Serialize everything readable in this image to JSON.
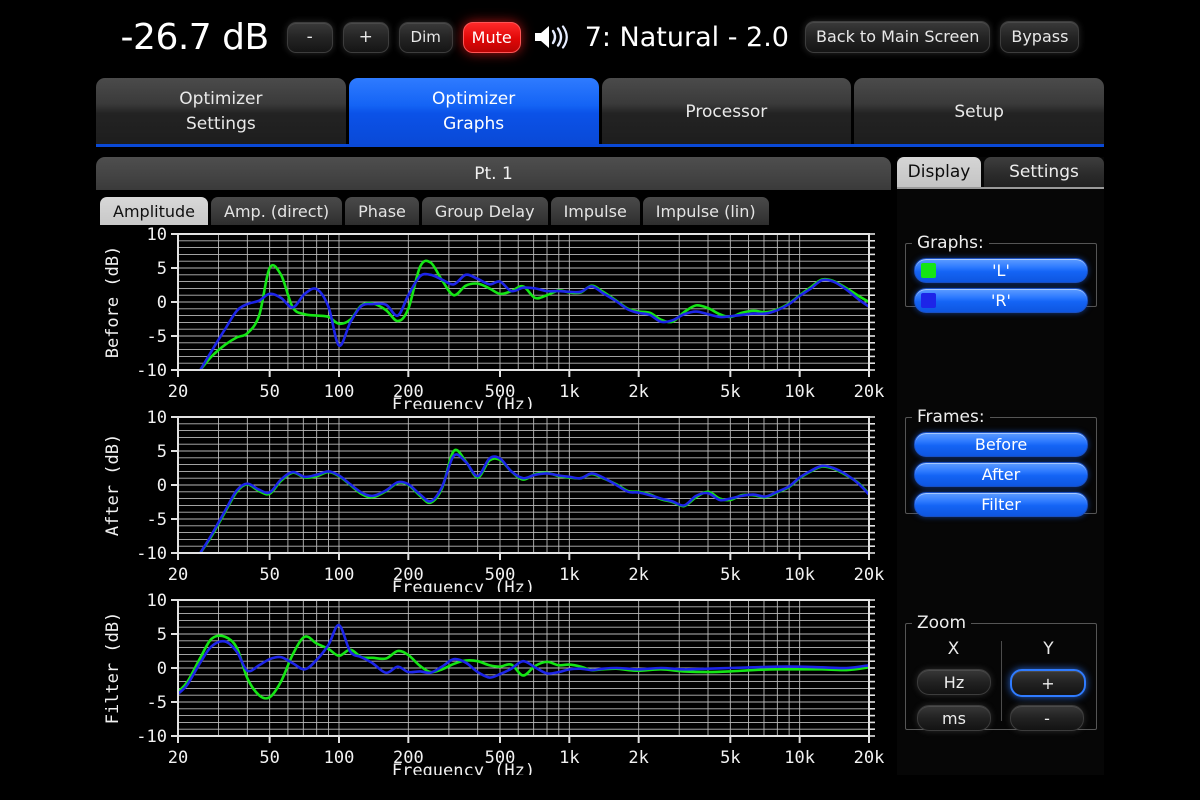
{
  "topbar": {
    "level": "-26.7 dB",
    "minus_label": "-",
    "plus_label": "+",
    "dim_label": "Dim",
    "mute_label": "Mute",
    "speaker_icon": "speaker-icon",
    "preset": "7: Natural - 2.0",
    "back_label": "Back to Main Screen",
    "bypass_label": "Bypass"
  },
  "main_tabs": [
    {
      "line1": "Optimizer",
      "line2": "Settings",
      "active": false
    },
    {
      "line1": "Optimizer",
      "line2": "Graphs",
      "active": true
    },
    {
      "line1": "Processor",
      "line2": "",
      "active": false
    },
    {
      "line1": "Setup",
      "line2": "",
      "active": false
    }
  ],
  "point_bar": {
    "label": "Pt. 1"
  },
  "sub_tabs": [
    {
      "label": "Amplitude",
      "active": true
    },
    {
      "label": "Amp. (direct)",
      "active": false
    },
    {
      "label": "Phase",
      "active": false
    },
    {
      "label": "Group Delay",
      "active": false
    },
    {
      "label": "Impulse",
      "active": false
    },
    {
      "label": "Impulse (lin)",
      "active": false
    }
  ],
  "right_panel": {
    "tabs": [
      {
        "label": "Display",
        "active": true
      },
      {
        "label": "Settings",
        "active": false
      }
    ],
    "graphs": {
      "legend": "Graphs:",
      "items": [
        {
          "label": "'L'",
          "color": "#15e515"
        },
        {
          "label": "'R'",
          "color": "#1d25e8"
        }
      ]
    },
    "frames": {
      "legend": "Frames:",
      "items": [
        {
          "label": "Before"
        },
        {
          "label": "After"
        },
        {
          "label": "Filter"
        }
      ]
    },
    "zoom": {
      "legend": "Zoom",
      "x_header": "X",
      "y_header": "Y",
      "x_buttons": [
        {
          "label": "Hz",
          "selected": false
        },
        {
          "label": "ms",
          "selected": false
        }
      ],
      "y_buttons": [
        {
          "label": "+",
          "selected": true
        },
        {
          "label": "-",
          "selected": false
        }
      ]
    }
  },
  "colors": {
    "accent_blue": "#0a49d6",
    "mute_red": "#e00707",
    "curve_left": "#15e515",
    "curve_right": "#1d25e8",
    "grid": "#b9b9b9",
    "plot_bg": "#000000"
  },
  "chart_data": [
    {
      "type": "line",
      "title": "Before",
      "ylabel": "Before (dB)",
      "xlabel": "Frequency (Hz)",
      "xscale": "log",
      "xlim": [
        20,
        20000
      ],
      "ylim": [
        -10,
        10
      ],
      "xticks": [
        20,
        50,
        100,
        200,
        500,
        1000,
        2000,
        5000,
        10000,
        20000
      ],
      "xticklabels": [
        "20",
        "50",
        "100",
        "200",
        "500",
        "1k",
        "2k",
        "5k",
        "10k",
        "20k"
      ],
      "yticks": [
        -10,
        -5,
        0,
        5,
        10
      ],
      "yticklabels": [
        "-10",
        "-5",
        "0",
        "5",
        "10"
      ],
      "grid": true,
      "legend": [
        "'L'",
        "'R'"
      ],
      "legend_position": "external-right",
      "series": [
        {
          "name": "'L'",
          "color": "#15e515",
          "x": [
            25,
            28,
            32,
            36,
            40,
            45,
            50,
            56,
            63,
            71,
            80,
            90,
            100,
            112,
            125,
            140,
            160,
            180,
            200,
            225,
            250,
            280,
            315,
            355,
            400,
            450,
            500,
            560,
            630,
            710,
            800,
            900,
            1000,
            1120,
            1250,
            1400,
            1600,
            1800,
            2000,
            2240,
            2500,
            2800,
            3150,
            3550,
            4000,
            4500,
            5000,
            5600,
            6300,
            7100,
            8000,
            9000,
            10000,
            11200,
            12500,
            14000,
            16000,
            18000,
            20000
          ],
          "y": [
            -10.0,
            -8.0,
            -6.3,
            -5.2,
            -4.6,
            -2.0,
            5.0,
            4.0,
            -0.8,
            -1.8,
            -2.0,
            -2.2,
            -3.2,
            -2.6,
            -0.5,
            -0.2,
            -1.2,
            -2.8,
            -1.0,
            5.2,
            5.8,
            3.2,
            1.0,
            2.4,
            2.7,
            2.0,
            1.2,
            1.6,
            2.3,
            0.6,
            1.0,
            1.7,
            1.4,
            1.4,
            2.4,
            1.5,
            0.2,
            -1.0,
            -1.4,
            -1.6,
            -2.6,
            -2.9,
            -1.5,
            -0.5,
            -0.9,
            -1.8,
            -2.2,
            -1.6,
            -1.3,
            -1.5,
            -1.1,
            -0.2,
            1.0,
            2.2,
            3.3,
            3.1,
            2.0,
            0.9,
            0.0
          ]
        },
        {
          "name": "'R'",
          "color": "#1d25e8",
          "x": [
            25,
            28,
            32,
            36,
            40,
            45,
            50,
            56,
            63,
            71,
            80,
            90,
            100,
            112,
            125,
            140,
            160,
            180,
            200,
            225,
            250,
            280,
            315,
            355,
            400,
            450,
            500,
            560,
            630,
            710,
            800,
            900,
            1000,
            1120,
            1250,
            1400,
            1600,
            1800,
            2000,
            2240,
            2500,
            2800,
            3150,
            3550,
            4000,
            4500,
            5000,
            5600,
            6300,
            7100,
            8000,
            9000,
            10000,
            11200,
            12500,
            14000,
            16000,
            18000,
            20000
          ],
          "y": [
            -10.0,
            -7.2,
            -4.0,
            -1.3,
            -0.3,
            0.2,
            1.2,
            0.6,
            -0.8,
            1.2,
            1.9,
            -0.7,
            -6.4,
            -3.0,
            -0.6,
            -0.3,
            -0.4,
            -2.0,
            1.0,
            3.8,
            4.0,
            3.3,
            2.6,
            4.0,
            3.4,
            2.6,
            3.0,
            1.6,
            2.1,
            2.0,
            1.6,
            1.6,
            1.5,
            1.5,
            2.3,
            1.3,
            0.1,
            -1.1,
            -1.6,
            -1.9,
            -2.9,
            -2.7,
            -1.8,
            -1.4,
            -1.8,
            -2.2,
            -2.1,
            -1.9,
            -1.7,
            -1.7,
            -1.2,
            -0.3,
            0.9,
            2.0,
            3.2,
            3.0,
            1.8,
            0.4,
            -0.7
          ]
        }
      ]
    },
    {
      "type": "line",
      "title": "After",
      "ylabel": "After (dB)",
      "xlabel": "Frequency (Hz)",
      "xscale": "log",
      "xlim": [
        20,
        20000
      ],
      "ylim": [
        -10,
        10
      ],
      "xticks": [
        20,
        50,
        100,
        200,
        500,
        1000,
        2000,
        5000,
        10000,
        20000
      ],
      "xticklabels": [
        "20",
        "50",
        "100",
        "200",
        "500",
        "1k",
        "2k",
        "5k",
        "10k",
        "20k"
      ],
      "yticks": [
        -10,
        -5,
        0,
        5,
        10
      ],
      "yticklabels": [
        "-10",
        "-5",
        "0",
        "5",
        "10"
      ],
      "grid": true,
      "series": [
        {
          "name": "'L'",
          "color": "#15e515",
          "x": [
            25,
            28,
            32,
            36,
            40,
            45,
            50,
            56,
            63,
            71,
            80,
            90,
            100,
            112,
            125,
            140,
            160,
            180,
            200,
            225,
            250,
            280,
            315,
            355,
            400,
            450,
            500,
            560,
            630,
            710,
            800,
            900,
            1000,
            1120,
            1250,
            1400,
            1600,
            1800,
            2000,
            2240,
            2500,
            2800,
            3150,
            3550,
            4000,
            4500,
            5000,
            5600,
            6300,
            7100,
            8000,
            9000,
            10000,
            11200,
            12500,
            14000,
            16000,
            18000,
            20000
          ],
          "y": [
            -10.0,
            -7.5,
            -4.0,
            -1.0,
            0.1,
            -0.9,
            -1.3,
            0.6,
            1.8,
            1.1,
            1.3,
            1.9,
            1.3,
            0.0,
            -1.3,
            -1.8,
            -0.9,
            0.3,
            0.0,
            -1.6,
            -2.6,
            -0.5,
            5.0,
            3.5,
            1.1,
            3.6,
            3.7,
            2.0,
            0.8,
            1.6,
            1.8,
            1.3,
            1.1,
            1.0,
            1.6,
            1.0,
            0.1,
            -0.9,
            -1.0,
            -1.4,
            -2.1,
            -2.5,
            -3.1,
            -1.8,
            -1.0,
            -2.0,
            -2.2,
            -1.5,
            -1.5,
            -1.8,
            -1.1,
            -0.3,
            1.0,
            2.0,
            2.7,
            2.4,
            1.4,
            0.3,
            -1.3
          ]
        },
        {
          "name": "'R'",
          "color": "#1d25e8",
          "x": [
            25,
            28,
            32,
            36,
            40,
            45,
            50,
            56,
            63,
            71,
            80,
            90,
            100,
            112,
            125,
            140,
            160,
            180,
            200,
            225,
            250,
            280,
            315,
            355,
            400,
            450,
            500,
            560,
            630,
            710,
            800,
            900,
            1000,
            1120,
            1250,
            1400,
            1600,
            1800,
            2000,
            2240,
            2500,
            2800,
            3150,
            3550,
            4000,
            4500,
            5000,
            5600,
            6300,
            7100,
            8000,
            9000,
            10000,
            11200,
            12500,
            14000,
            16000,
            18000,
            20000
          ],
          "y": [
            -10.0,
            -7.3,
            -3.8,
            -0.8,
            0.2,
            -0.7,
            -1.1,
            0.8,
            1.9,
            1.2,
            1.5,
            2.0,
            1.4,
            0.1,
            -1.1,
            -1.6,
            -0.8,
            0.4,
            0.1,
            -1.4,
            -2.4,
            -0.3,
            4.3,
            3.4,
            1.3,
            3.9,
            3.9,
            2.0,
            1.0,
            1.5,
            1.7,
            1.4,
            1.2,
            1.0,
            1.7,
            1.1,
            0.0,
            -1.0,
            -1.1,
            -1.5,
            -2.0,
            -2.4,
            -3.0,
            -1.6,
            -1.2,
            -2.2,
            -2.0,
            -1.6,
            -1.4,
            -1.7,
            -1.0,
            -0.2,
            1.1,
            2.1,
            2.8,
            2.5,
            1.5,
            0.2,
            -1.4
          ]
        }
      ]
    },
    {
      "type": "line",
      "title": "Filter",
      "ylabel": "Filter (dB)",
      "xlabel": "Frequency (Hz)",
      "xscale": "log",
      "xlim": [
        20,
        20000
      ],
      "ylim": [
        -10,
        10
      ],
      "xticks": [
        20,
        50,
        100,
        200,
        500,
        1000,
        2000,
        5000,
        10000,
        20000
      ],
      "xticklabels": [
        "20",
        "50",
        "100",
        "200",
        "500",
        "1k",
        "2k",
        "5k",
        "10k",
        "20k"
      ],
      "yticks": [
        -10,
        -5,
        0,
        5,
        10
      ],
      "yticklabels": [
        "-10",
        "-5",
        "0",
        "5",
        "10"
      ],
      "grid": true,
      "series": [
        {
          "name": "'L'",
          "color": "#15e515",
          "x": [
            20,
            22,
            25,
            28,
            32,
            36,
            40,
            45,
            50,
            56,
            63,
            71,
            80,
            90,
            100,
            112,
            125,
            140,
            160,
            180,
            200,
            225,
            250,
            280,
            315,
            355,
            400,
            450,
            500,
            560,
            630,
            710,
            800,
            900,
            1000,
            1120,
            1250,
            1400,
            1600,
            1800,
            2000,
            2500,
            3150,
            4000,
            5000,
            6300,
            8000,
            10000,
            12500,
            16000,
            20000
          ],
          "y": [
            -3.5,
            -2.0,
            1.5,
            4.3,
            4.6,
            3.0,
            -1.5,
            -4.0,
            -4.3,
            -2.0,
            2.0,
            4.6,
            3.6,
            2.8,
            1.8,
            2.7,
            1.6,
            1.5,
            1.4,
            2.5,
            1.9,
            0.3,
            -0.6,
            -0.2,
            0.6,
            1.1,
            1.0,
            0.4,
            0.2,
            0.5,
            -1.1,
            0.3,
            0.9,
            0.4,
            0.5,
            0.2,
            -0.3,
            -0.2,
            -0.1,
            -0.3,
            -0.4,
            -0.2,
            -0.5,
            -0.6,
            -0.5,
            -0.3,
            -0.2,
            -0.2,
            -0.2,
            -0.3,
            0.1
          ]
        },
        {
          "name": "'R'",
          "color": "#1d25e8",
          "x": [
            20,
            22,
            25,
            28,
            32,
            36,
            40,
            45,
            50,
            56,
            63,
            71,
            80,
            90,
            100,
            112,
            125,
            140,
            160,
            180,
            200,
            225,
            250,
            280,
            315,
            355,
            400,
            450,
            500,
            560,
            630,
            710,
            800,
            900,
            1000,
            1120,
            1250,
            1400,
            1600,
            1800,
            2000,
            2500,
            3150,
            4000,
            5000,
            6300,
            8000,
            10000,
            12500,
            16000,
            20000
          ],
          "y": [
            -3.8,
            -2.4,
            0.8,
            3.2,
            3.9,
            2.4,
            -0.4,
            0.4,
            1.3,
            1.6,
            0.7,
            -0.2,
            1.2,
            3.4,
            6.3,
            2.4,
            1.6,
            0.7,
            -0.7,
            0.2,
            -0.6,
            -0.5,
            -0.7,
            0.2,
            1.3,
            0.8,
            -0.6,
            -1.4,
            -0.9,
            -0.1,
            1.0,
            0.1,
            -0.8,
            -0.6,
            -0.2,
            -0.1,
            -0.3,
            -0.1,
            0.0,
            -0.1,
            -0.2,
            0.0,
            -0.2,
            -0.1,
            0.0,
            0.1,
            0.2,
            0.2,
            0.1,
            0.0,
            0.4
          ]
        }
      ]
    }
  ]
}
